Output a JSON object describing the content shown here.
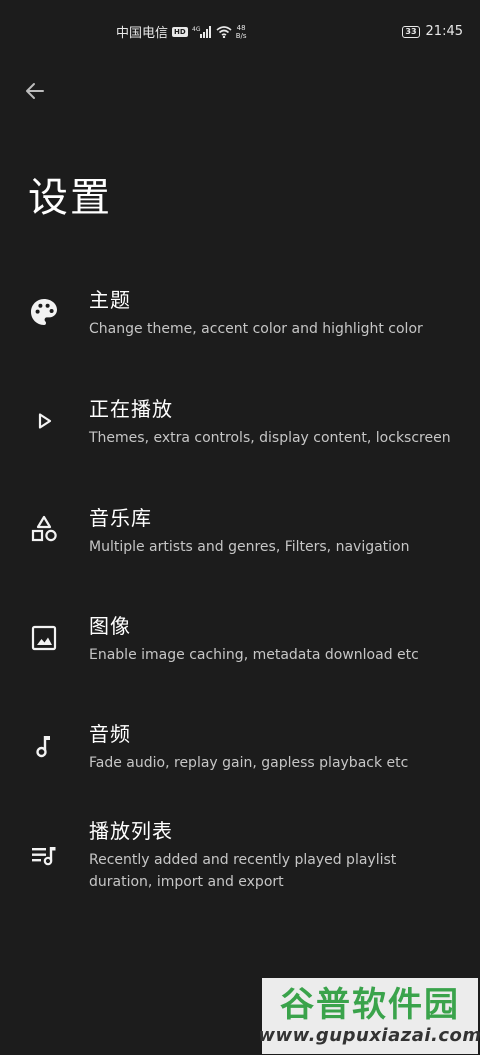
{
  "status_bar": {
    "carrier": "中国电信",
    "hd_badge": "HD",
    "signal_label": "4G",
    "net_speed_value": "48",
    "net_speed_unit": "B/s",
    "battery": "33",
    "time": "21:45"
  },
  "header": {
    "back_icon": "arrow-left-icon",
    "title": "设置"
  },
  "settings": [
    {
      "icon": "palette-icon",
      "title": "主题",
      "description": "Change theme, accent color and highlight color"
    },
    {
      "icon": "play-icon",
      "title": "正在播放",
      "description": "Themes, extra controls, display content, lockscreen"
    },
    {
      "icon": "shapes-icon",
      "title": "音乐库",
      "description": "Multiple artists and genres, Filters, navigation"
    },
    {
      "icon": "image-icon",
      "title": "图像",
      "description": "Enable image caching, metadata download etc"
    },
    {
      "icon": "music-note-icon",
      "title": "音频",
      "description": "Fade audio, replay gain, gapless playback etc"
    },
    {
      "icon": "playlist-icon",
      "title": "播放列表",
      "description": "Recently added and recently played playlist duration, import and export"
    }
  ],
  "watermark": {
    "title": "谷普软件园",
    "url": "www.gupuxiazai.com"
  },
  "colors": {
    "background": "#1c1c1c",
    "text_primary": "#ffffff",
    "text_secondary": "#c6c6c6",
    "watermark_green": "#3aa34b"
  }
}
